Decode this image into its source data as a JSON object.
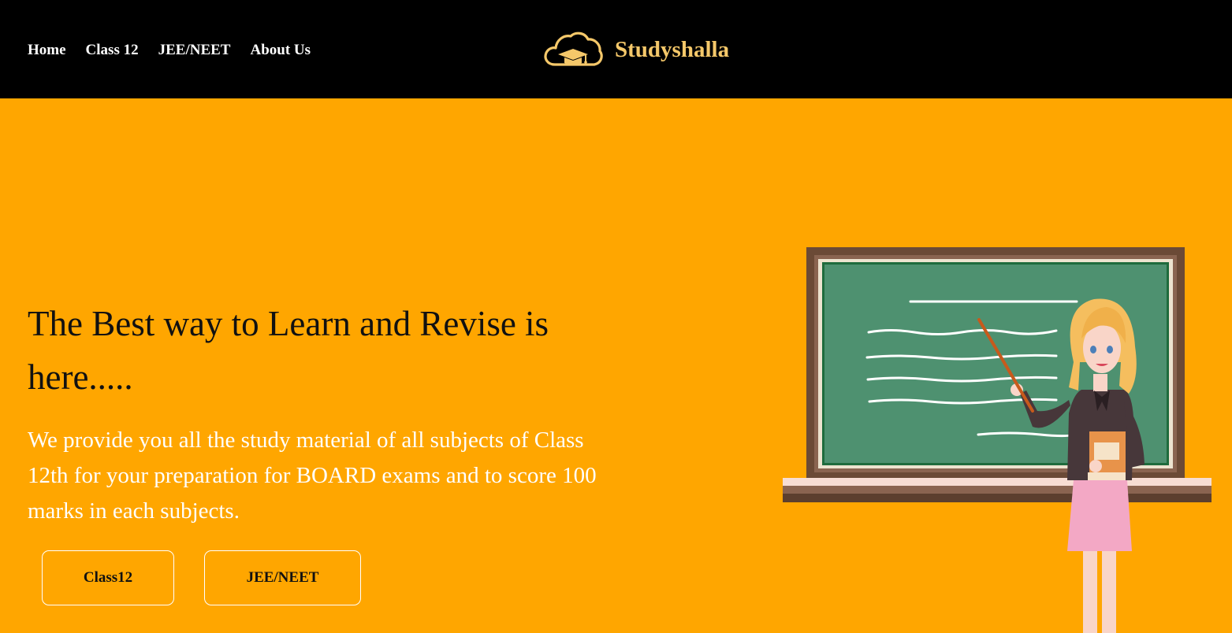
{
  "nav": {
    "links": [
      "Home",
      "Class 12",
      "JEE/NEET",
      "About Us"
    ]
  },
  "brand": {
    "name": "Studyshalla",
    "logo_icon": "cloud-graduation-cap-icon",
    "color": "#F5C86A"
  },
  "hero": {
    "title": "The Best way to Learn and Revise is here.....",
    "text": "We provide you all the study material of all subjects of Class 12th for your preparation for BOARD exams and to score 100 marks in each subjects.",
    "buttons": {
      "class12": "Class12",
      "jee": "JEE/NEET"
    },
    "illustration": "teacher-at-chalkboard-illustration"
  },
  "colors": {
    "background": "#FFA600",
    "navbar": "#000000",
    "chalkboard": "#4E9170"
  }
}
